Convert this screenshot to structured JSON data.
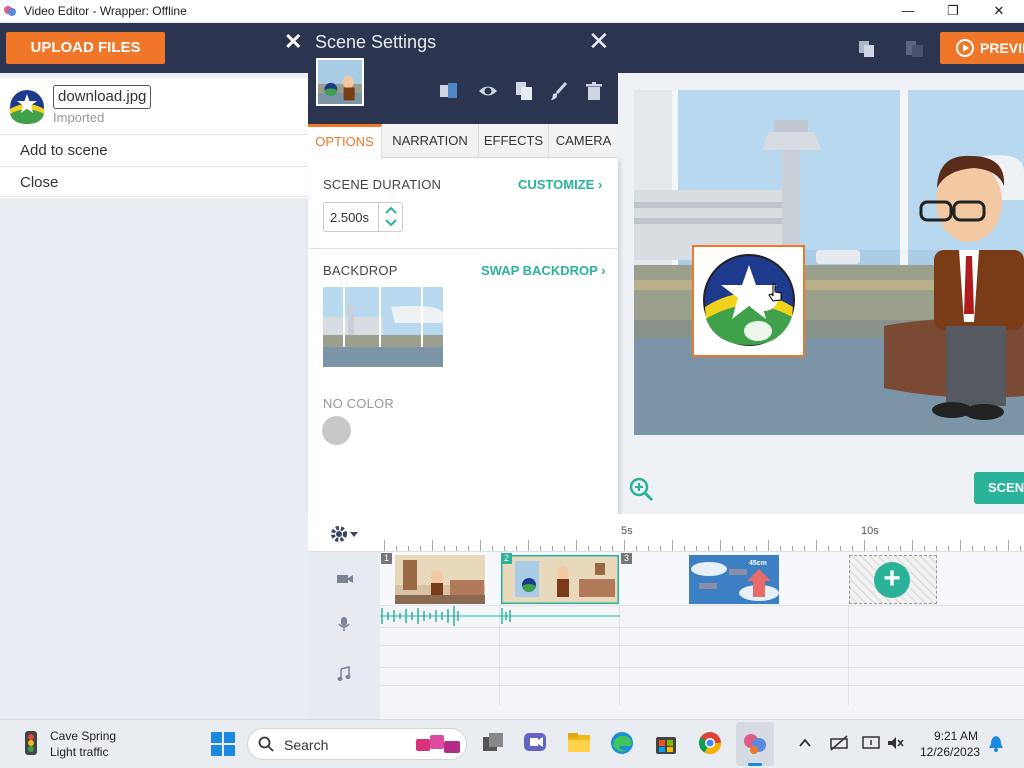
{
  "window": {
    "title": "Video Editor - Wrapper: Offline",
    "controls": {
      "minimize": "—",
      "maximize": "❐",
      "close": "✕"
    }
  },
  "toolbar": {
    "upload_label": "UPLOAD FILES",
    "preview_label": "PREVIEW"
  },
  "asset_panel": {
    "file_name": "download.jpg",
    "status": "Imported",
    "menu": [
      "Add to scene",
      "Close"
    ]
  },
  "scene_settings": {
    "title": "Scene Settings",
    "close_glyph": "✕",
    "collapse_glyph": "✕",
    "tabs": [
      "OPTIONS",
      "NARRATION",
      "EFFECTS",
      "CAMERA"
    ],
    "active_tab": "OPTIONS",
    "duration_label": "SCENE DURATION",
    "customize_label": "CUSTOMIZE",
    "duration_value": "2.500s",
    "backdrop_label": "BACKDROP",
    "swap_label": "SWAP BACKDROP",
    "color_label": "NO COLOR",
    "chevron": "›"
  },
  "stage": {
    "scene_button_label": "SCENE"
  },
  "timeline": {
    "markers": [
      "5s",
      "10s"
    ],
    "clip_numbers": [
      "1",
      "2",
      "3"
    ],
    "add_glyph": "+",
    "poster_label": "45cm"
  },
  "taskbar": {
    "weather_location": "Cave Spring",
    "weather_status": "Light traffic",
    "search_label": "Search",
    "time": "9:21 AM",
    "date": "12/26/2023"
  },
  "colors": {
    "accent_orange": "#f0762a",
    "accent_green": "#2bb39a",
    "header_navy": "#2c3550"
  }
}
